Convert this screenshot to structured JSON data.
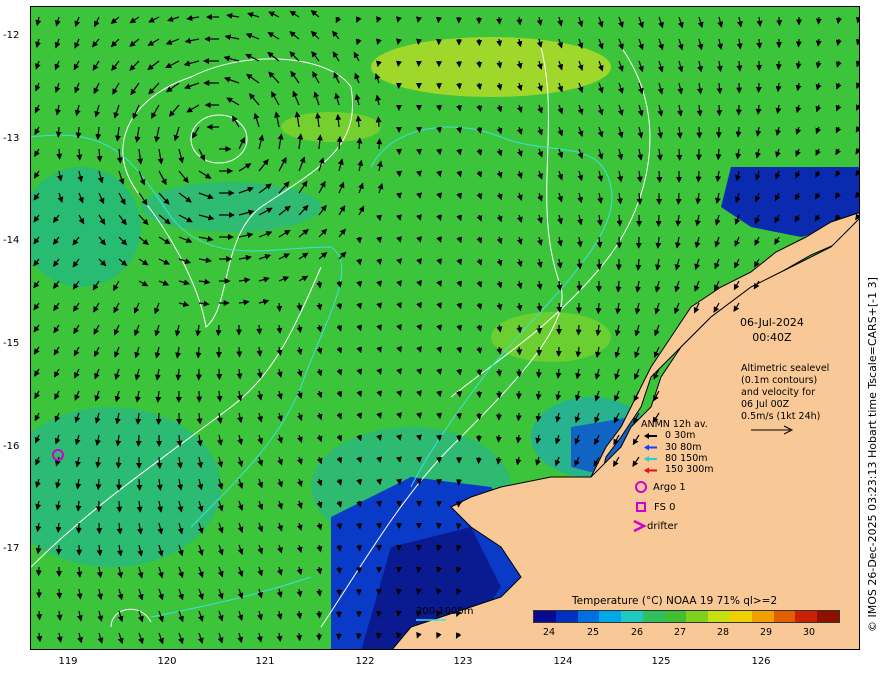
{
  "map": {
    "lat_ticks": [
      "-12",
      "-13",
      "-14",
      "-15",
      "-16",
      "-17"
    ],
    "lon_ticks": [
      "119",
      "120",
      "121",
      "122",
      "123",
      "124",
      "125",
      "126"
    ],
    "date": "06-Jul-2024",
    "time": "00:40Z",
    "altimetry_lines": [
      "Altimetric sealevel",
      "(0.1m contours)",
      "and velocity for",
      "06 Jul 00Z",
      "0.5m/s (1kt 24h)"
    ],
    "current_legend": {
      "title": "ANMN 12h av.",
      "items": [
        {
          "label": "0 30m",
          "color": "#000000"
        },
        {
          "label": "30 80m",
          "color": "#1a3cff"
        },
        {
          "label": "80 150m",
          "color": "#22d2d2"
        },
        {
          "label": "150 300m",
          "color": "#e01010"
        }
      ]
    },
    "markers": [
      {
        "label": "Argo 1",
        "symbol": "circle",
        "color": "#d000d0"
      },
      {
        "label": "FS 0",
        "symbol": "square",
        "color": "#d000d0"
      },
      {
        "label": "drifter",
        "symbol": "chevron",
        "color": "#d000d0"
      }
    ],
    "bathymetry_label": "200  1000m",
    "colorbar": {
      "title": "Temperature (°C) NOAA 19 71% ql>=2",
      "ticks": [
        "24",
        "25",
        "26",
        "27",
        "28",
        "29",
        "30"
      ],
      "colors": [
        "#0a0a90",
        "#0030c0",
        "#0070e0",
        "#00a8e8",
        "#20c8c0",
        "#30c060",
        "#40c030",
        "#80d020",
        "#c8e010",
        "#f0d000",
        "#f0a000",
        "#e06000",
        "#c82000",
        "#901000"
      ]
    },
    "copyright": "© IMOS 26-Dec-2025 03:23:13 Hobart time Tscale=CARS+[-1 3]"
  }
}
